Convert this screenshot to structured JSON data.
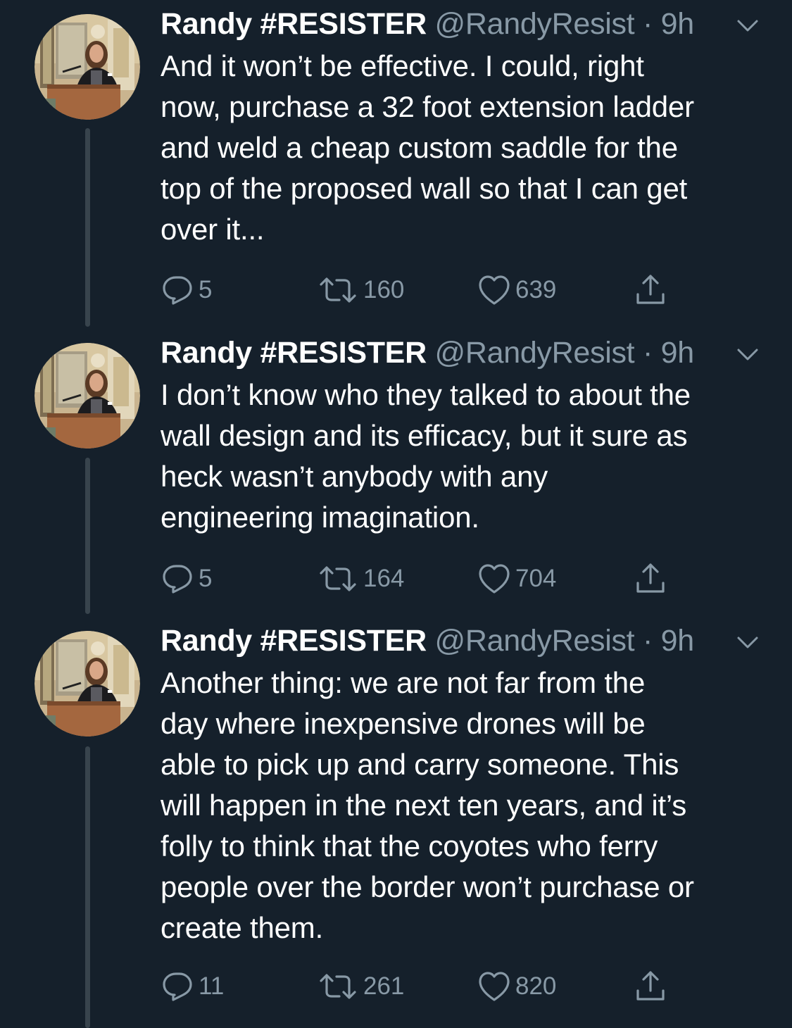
{
  "author": {
    "name": "Randy #RESISTER",
    "handle": "@RandyResist",
    "separator": "·"
  },
  "icons": {
    "reply": "speech-bubble-icon",
    "retweet": "retweet-arrows-icon",
    "like": "heart-icon",
    "share": "share-upload-icon",
    "menu": "chevron-down-icon"
  },
  "colors": {
    "background": "#15202b",
    "secondary_text": "#8899a6",
    "thread_line": "#38444d"
  },
  "tweets": [
    {
      "time": "9h",
      "lines": [
        "And it won’t be effective. I could, right",
        "now, purchase a 32 foot extension ladder",
        "and weld a cheap custom saddle for the",
        "top of the proposed wall so that I can get",
        "over it..."
      ],
      "replies": "5",
      "retweets": "160",
      "likes": "639"
    },
    {
      "time": "9h",
      "lines": [
        "I don’t know who they talked to about the",
        "wall design and its efficacy, but it sure as",
        "heck wasn’t anybody with any",
        "engineering imagination."
      ],
      "replies": "5",
      "retweets": "164",
      "likes": "704"
    },
    {
      "time": "9h",
      "lines": [
        "Another thing: we are not far from the",
        "day where inexpensive drones will be",
        "able to pick up and carry someone. This",
        "will happen in the next ten years, and it’s",
        "folly to think that the coyotes who ferry",
        "people over the border won’t purchase or",
        "create them."
      ],
      "replies": "11",
      "retweets": "261",
      "likes": "820"
    }
  ]
}
